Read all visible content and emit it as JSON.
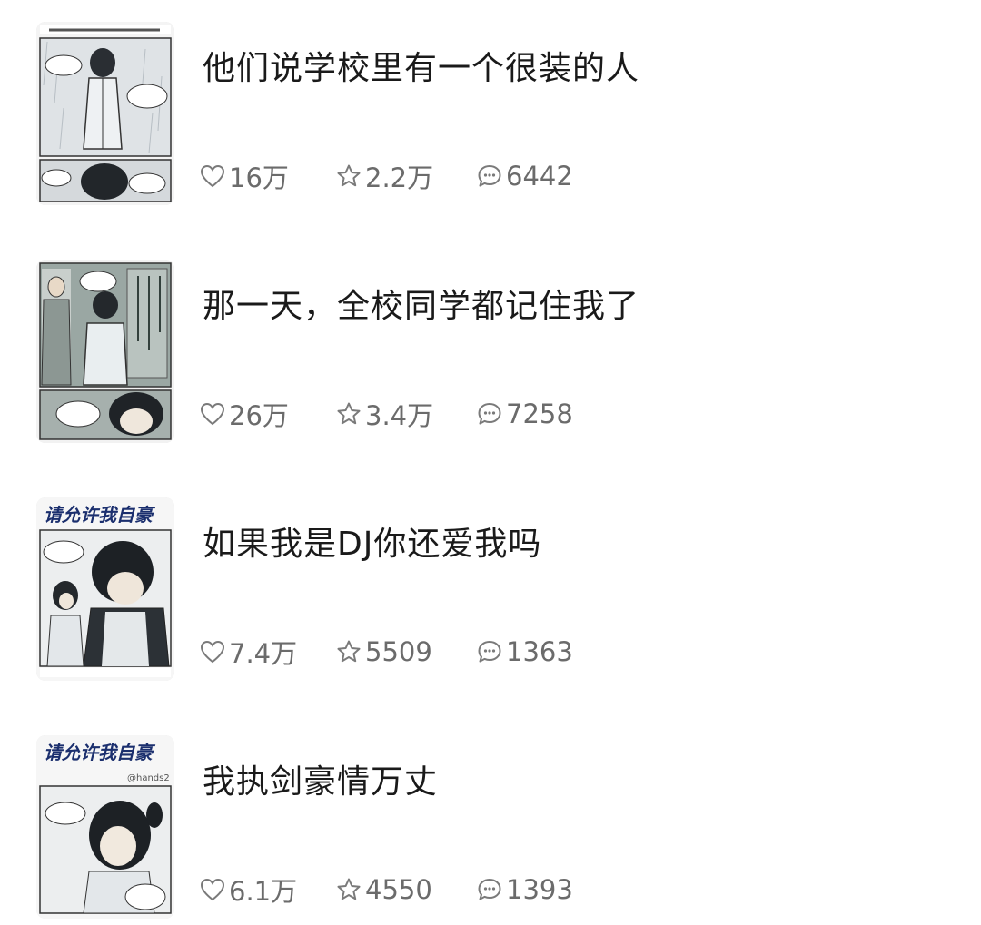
{
  "feed": {
    "items": [
      {
        "cover_icon": "comic-cover-image",
        "title": "他们说学校里有一个很装的人",
        "likes": "16万",
        "favorites": "2.2万",
        "comments": "6442"
      },
      {
        "cover_icon": "comic-cover-image",
        "title": "那一天，全校同学都记住我了",
        "likes": "26万",
        "favorites": "3.4万",
        "comments": "7258"
      },
      {
        "cover_icon": "comic-cover-image",
        "cover_heading": "请允许我自豪",
        "title": "如果我是DJ你还爱我吗",
        "likes": "7.4万",
        "favorites": "5509",
        "comments": "1363"
      },
      {
        "cover_icon": "comic-cover-image",
        "cover_heading": "请允许我自豪",
        "cover_credit": "@hands2",
        "title": "我执剑豪情万丈",
        "likes": "6.1万",
        "favorites": "4550",
        "comments": "1393"
      }
    ]
  },
  "icons": {
    "like": "heart-outline-icon",
    "favorite": "star-outline-icon",
    "comment": "speech-bubble-icon"
  },
  "colors": {
    "title": "#1a1a1a",
    "stat_text": "#6b6b6b",
    "icon_stroke": "#7a7a7a",
    "cover_heading": "#1b2f6e"
  }
}
